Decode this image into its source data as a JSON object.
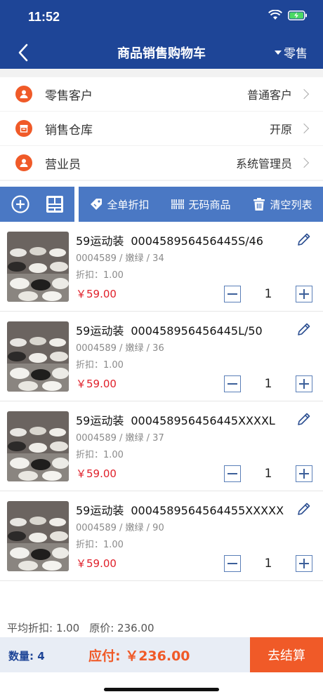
{
  "status": {
    "time": "11:52"
  },
  "nav": {
    "title": "商品销售购物车",
    "mode_label": "零售"
  },
  "info_rows": [
    {
      "label": "零售客户",
      "value": "普通客户"
    },
    {
      "label": "销售仓库",
      "value": "开原"
    },
    {
      "label": "营业员",
      "value": "系统管理员"
    }
  ],
  "toolbar": {
    "actions": [
      {
        "label": "全单折扣",
        "icon": "tag-icon"
      },
      {
        "label": "无码商品",
        "icon": "barcode-icon"
      },
      {
        "label": "清空列表",
        "icon": "trash-icon"
      }
    ]
  },
  "cart": {
    "items": [
      {
        "name": "59运动装",
        "code": "000458956456445S/46",
        "sub": "0004589 / 嫩绿 / 34",
        "discount": "折扣：1.00",
        "price": "￥59.00",
        "qty": "1"
      },
      {
        "name": "59运动装",
        "code": "000458956456445L/50",
        "sub": "0004589 / 嫩绿 / 36",
        "discount": "折扣：1.00",
        "price": "￥59.00",
        "qty": "1"
      },
      {
        "name": "59运动装",
        "code": "000458956456445XXXXL",
        "sub": "0004589 / 嫩绿 / 37",
        "discount": "折扣：1.00",
        "price": "￥59.00",
        "qty": "1"
      },
      {
        "name": "59运动装",
        "code": "0004589564564455XXXXX",
        "sub": "0004589 / 嫩绿 / 90",
        "discount": "折扣：1.00",
        "price": "￥59.00",
        "qty": "1"
      }
    ]
  },
  "summary": {
    "avg_discount": "平均折扣: 1.00",
    "original_price": "原价: 236.00"
  },
  "footer": {
    "count": "数量: 4",
    "payable": "应付: ￥236.00",
    "checkout_label": "去结算"
  },
  "colors": {
    "primary": "#1e4597",
    "accent": "#f05a28",
    "toolbar": "#4a78c4",
    "price": "#e0202a"
  }
}
